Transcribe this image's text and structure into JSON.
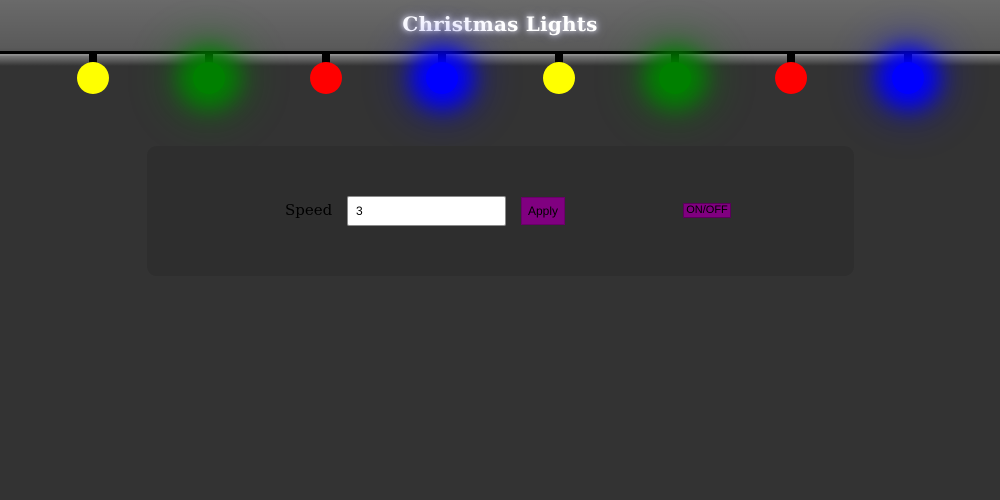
{
  "header": {
    "title": "Christmas Lights"
  },
  "lights": [
    {
      "color": "#ffff00",
      "glow": false
    },
    {
      "color": "#008000",
      "glow": true
    },
    {
      "color": "#ff0000",
      "glow": false
    },
    {
      "color": "#0000ff",
      "glow": true
    },
    {
      "color": "#ffff00",
      "glow": false
    },
    {
      "color": "#008000",
      "glow": true
    },
    {
      "color": "#ff0000",
      "glow": false
    },
    {
      "color": "#0000ff",
      "glow": true
    }
  ],
  "controls": {
    "speed_label": "Speed",
    "speed_value": "3",
    "apply_label": "Apply",
    "toggle_label": "ON/OFF"
  },
  "colors": {
    "background": "#333333",
    "button": "#800080"
  }
}
